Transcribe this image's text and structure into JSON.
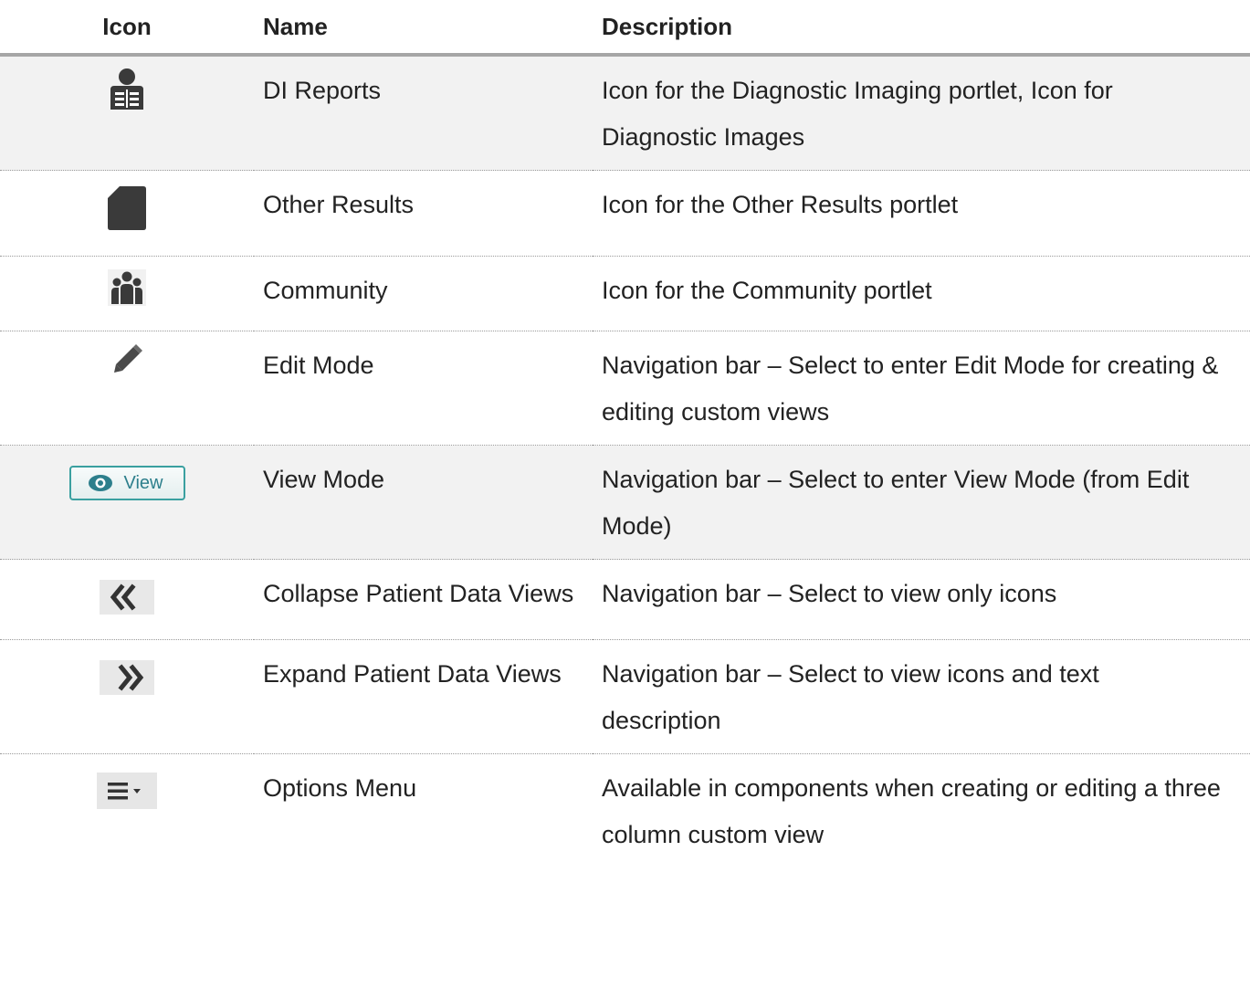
{
  "headers": {
    "icon": "Icon",
    "name": "Name",
    "description": "Description"
  },
  "rows": [
    {
      "icon": "di-reports-icon",
      "name": "DI Reports",
      "description": "Icon for the Diagnostic Imaging portlet, Icon for Diagnostic Images"
    },
    {
      "icon": "other-results-icon",
      "name": "Other Results",
      "description": "Icon for the Other Results portlet"
    },
    {
      "icon": "community-icon",
      "name": "Community",
      "description": "Icon for the Community portlet"
    },
    {
      "icon": "pencil-icon",
      "name": "Edit Mode",
      "description": "Navigation bar – Select to enter Edit Mode for creating & editing custom views"
    },
    {
      "icon": "view-button",
      "icon_label": "View",
      "name": "View Mode",
      "description": "Navigation bar – Select to enter View Mode (from Edit Mode)"
    },
    {
      "icon": "double-chevron-left-icon",
      "name": "Collapse Patient Data Views",
      "description": "Navigation bar – Select to view only icons"
    },
    {
      "icon": "double-chevron-right-icon",
      "name": "Expand Patient Data Views",
      "description": "Navigation bar – Select to view icons and text description"
    },
    {
      "icon": "options-menu-icon",
      "name": "Options Menu",
      "description": "Available in components when creating or editing a three column custom view"
    }
  ],
  "colors": {
    "header_rule": "#a6a6a6",
    "row_shade": "#f2f2f2",
    "icon_dark": "#3a3a3a",
    "view_button_accent": "#2d7f8c"
  }
}
